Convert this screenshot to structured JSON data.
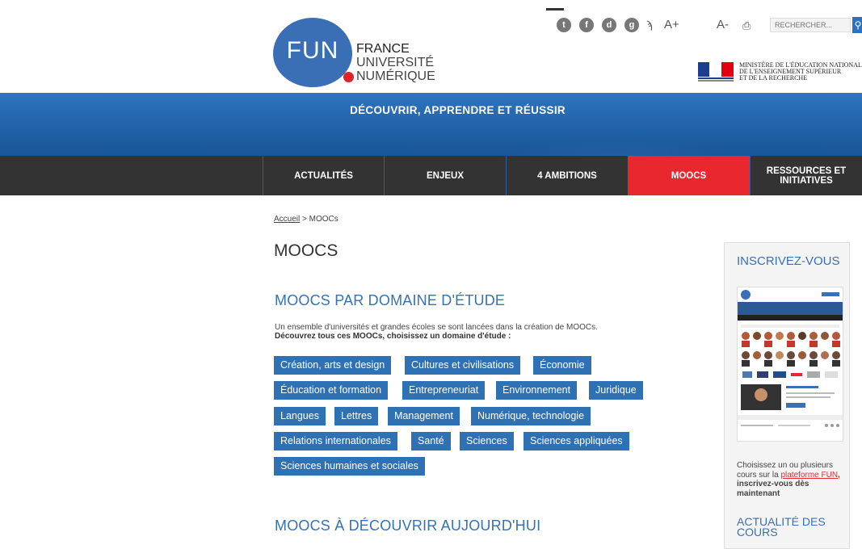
{
  "header": {
    "logo_text": "FUN",
    "brand_line1": "FRANCE",
    "brand_line2": "UNIVERSITÉ",
    "brand_line3": "NUMÉRIQUE",
    "text_size_up": "A+",
    "text_size_down": "A-",
    "search_placeholder": "RECHERCHER...",
    "ministry_line1": "MINISTÈRE DE L'ÉDUCATION NATIONALE",
    "ministry_line2": "DE L'ENSEIGNEMENT SUPÉRIEUR",
    "ministry_line3": "ET DE LA RECHERCHE",
    "social_icons": [
      "twitter-icon",
      "facebook-icon",
      "dailymotion-icon",
      "google-plus-icon",
      "rss-icon",
      "print-icon"
    ]
  },
  "banner": {
    "tagline": "DÉCOUVRIR, APPRENDRE ET RÉUSSIR"
  },
  "nav": {
    "items": [
      {
        "label": "ACTUALITÉS"
      },
      {
        "label": "ENJEUX"
      },
      {
        "label": "4 AMBITIONS"
      },
      {
        "label": "MOOCS",
        "active": true
      },
      {
        "label": "RESSOURCES ET INITIATIVES"
      }
    ]
  },
  "breadcrumb": {
    "home": "Accueil",
    "separator": " > ",
    "current": "MOOCs"
  },
  "main": {
    "title": "MOOCS",
    "section1_title": "MOOCS PAR DOMAINE D'ÉTUDE",
    "intro_line1": "Un ensemble d'universités et grandes écoles se sont lancées dans la création de MOOCs.",
    "intro_line2": "Découvrez tous ces MOOCs, choisissez un domaine d'étude :",
    "domains": [
      "Création, arts et design",
      "Cultures et civilisations",
      "Économie",
      "Éducation et formation",
      "Entrepreneuriat",
      "Environnement",
      "Juridique",
      "Langues",
      "Lettres",
      "Management",
      "Numérique, technologie",
      "Relations internationales",
      "Santé",
      "Sciences",
      "Sciences appliquées",
      "Sciences humaines et sociales"
    ],
    "section2_title": "MOOCS À DÉCOUVRIR AUJOURD'HUI"
  },
  "sidebar": {
    "title": "INSCRIVEZ-VOUS",
    "text_before": "Choisissez un ou plusieurs cours sur la ",
    "link": "plateforme FUN",
    "text_after": ", inscrivez-vous dès maintenant",
    "title2": "ACTUALITÉ DES COURS"
  },
  "colors": {
    "brand_blue": "#3a6fb5",
    "accent_red": "#e8282e",
    "nav_dark": "#333333",
    "tag_blue": "#2f71b5"
  }
}
